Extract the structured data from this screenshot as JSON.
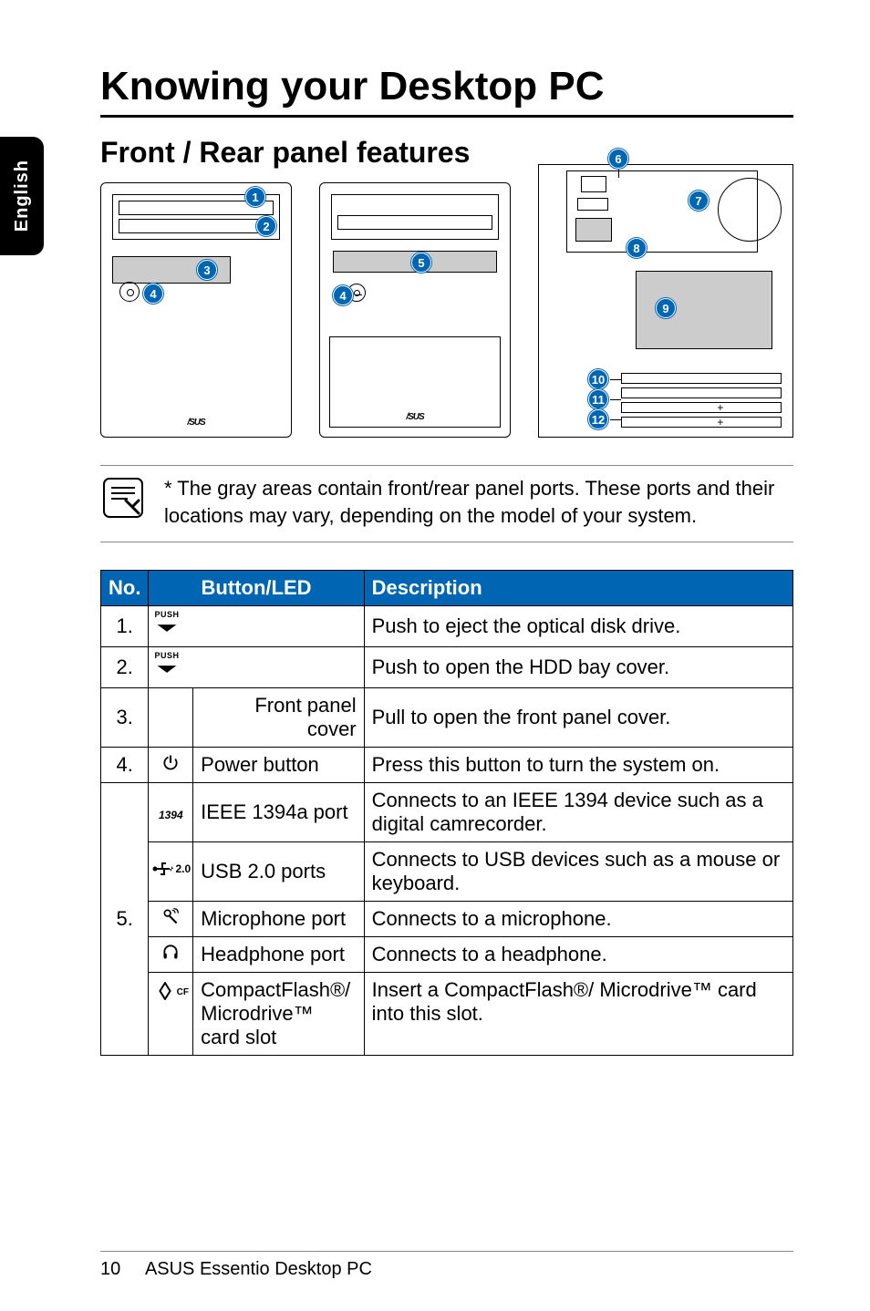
{
  "sideTab": "English",
  "title": "Knowing your Desktop PC",
  "subtitle": "Front / Rear panel features",
  "logoText": "/SUS",
  "callouts": [
    "1",
    "2",
    "3",
    "4",
    "5",
    "6",
    "7",
    "8",
    "9",
    "10",
    "11",
    "12"
  ],
  "noteText": "* The gray areas contain front/rear panel ports. These ports and their locations may vary, depending on the model of your system.",
  "table": {
    "headers": {
      "no": "No.",
      "btn": "Button/LED",
      "desc": "Description"
    },
    "rows": [
      {
        "no": "1.",
        "iconType": "push",
        "label": "",
        "desc": "Push to eject the optical disk drive."
      },
      {
        "no": "2.",
        "iconType": "push",
        "label": "",
        "desc": "Push to open the HDD bay cover."
      },
      {
        "no": "3.",
        "iconType": "none",
        "label": "Front panel cover",
        "desc": "Pull to open the front panel cover."
      },
      {
        "no": "4.",
        "iconType": "power",
        "label": "Power button",
        "desc": "Press this button to turn the system on."
      }
    ],
    "row5": {
      "no": "5.",
      "items": [
        {
          "iconType": "1394",
          "label": "IEEE 1394a port",
          "desc": "Connects to an IEEE 1394 device such as a digital camrecorder."
        },
        {
          "iconType": "usb",
          "label": "USB 2.0 ports",
          "desc": "Connects to USB devices such as a mouse or keyboard."
        },
        {
          "iconType": "mic",
          "label": "Microphone port",
          "desc": "Connects to a microphone."
        },
        {
          "iconType": "hp",
          "label": "Headphone port",
          "desc": "Connects to a headphone."
        },
        {
          "iconType": "cf",
          "label": "CompactFlash®/\nMicrodrive™\ncard slot",
          "desc": "Insert a CompactFlash®/ Microdrive™ card into this slot."
        }
      ]
    }
  },
  "footer": {
    "pageNum": "10",
    "bookTitle": "ASUS Essentio Desktop PC"
  },
  "icons": {
    "pushText": "PUSH",
    "ieee1394": "1394",
    "usb20": "2.0",
    "cf": "CF"
  }
}
